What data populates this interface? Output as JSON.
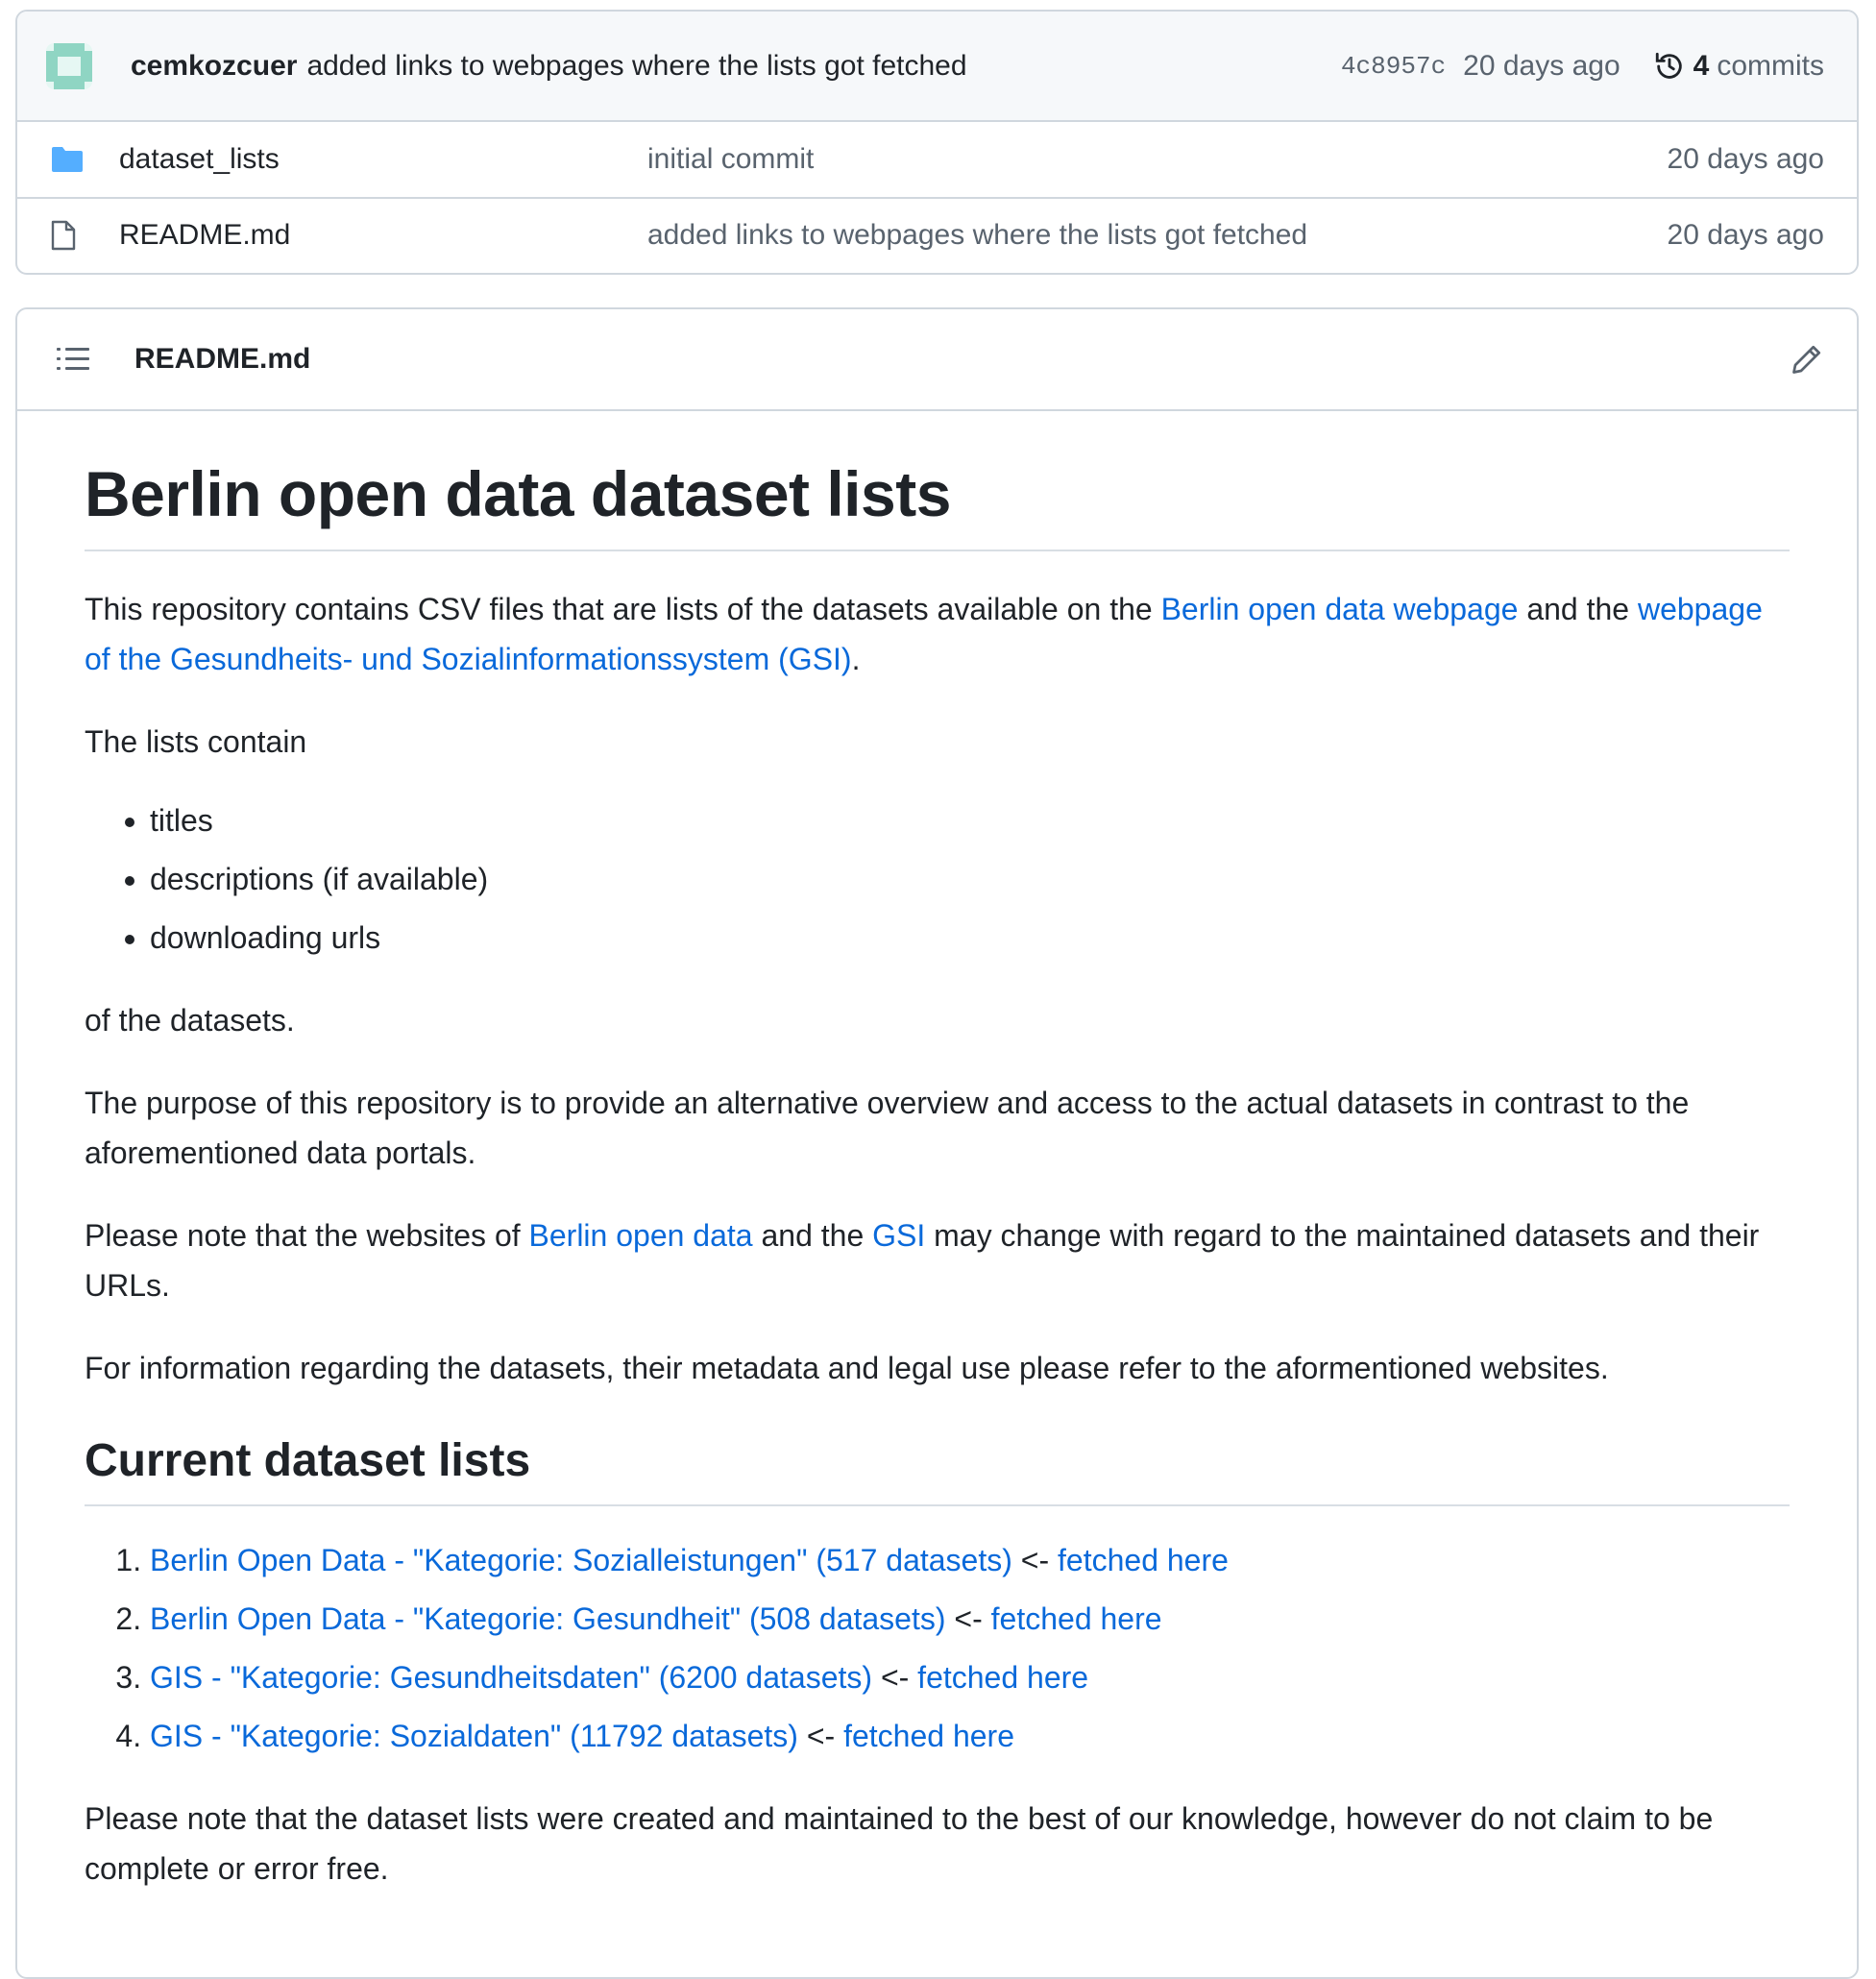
{
  "latest_commit": {
    "author": "cemkozcuer",
    "message": "added links to webpages where the lists got fetched",
    "sha": "4c8957c",
    "date": "20 days ago",
    "commit_count": "4",
    "commit_count_label": "commits"
  },
  "files": [
    {
      "name": "dataset_lists",
      "type": "folder",
      "commit": "initial commit",
      "date": "20 days ago"
    },
    {
      "name": "README.md",
      "type": "file",
      "commit": "added links to webpages where the lists got fetched",
      "date": "20 days ago"
    }
  ],
  "readme": {
    "filename": "README.md",
    "h1": "Berlin open data dataset lists",
    "p1": {
      "t1": "This repository contains CSV files that are lists of the datasets available on the ",
      "link1": "Berlin open data webpage",
      "t2": " and the ",
      "link2": "webpage of the Gesundheits- und Sozialinformationssystem (GSI)",
      "t3": "."
    },
    "p2": "The lists contain",
    "bullets": [
      "titles",
      "descriptions (if available)",
      "downloading urls"
    ],
    "p3": "of the datasets.",
    "p4": "The purpose of this repository is to provide an alternative overview and access to the actual datasets in contrast to the aforementioned data portals.",
    "p5": {
      "t1": "Please note that the websites of ",
      "link1": "Berlin open data",
      "t2": " and the ",
      "link2": "GSI",
      "t3": " may change with regard to the maintained datasets and their URLs."
    },
    "p6": "For information regarding the datasets, their metadata and legal use please refer to the aformentioned websites.",
    "h2": "Current dataset lists",
    "lists": [
      {
        "link": "Berlin Open Data - \"Kategorie: Sozialleistungen\" (517 datasets)",
        "sep": " <- ",
        "fetched": "fetched here"
      },
      {
        "link": "Berlin Open Data - \"Kategorie: Gesundheit\" (508 datasets)",
        "sep": " <- ",
        "fetched": "fetched here"
      },
      {
        "link": "GIS - \"Kategorie: Gesundheitsdaten\" (6200 datasets)",
        "sep": " <- ",
        "fetched": "fetched here"
      },
      {
        "link": "GIS - \"Kategorie: Sozialdaten\" (11792 datasets)",
        "sep": " <- ",
        "fetched": "fetched here"
      }
    ],
    "p7": "Please note that the dataset lists were created and maintained to the best of our knowledge, however do not claim to be complete or error free."
  }
}
